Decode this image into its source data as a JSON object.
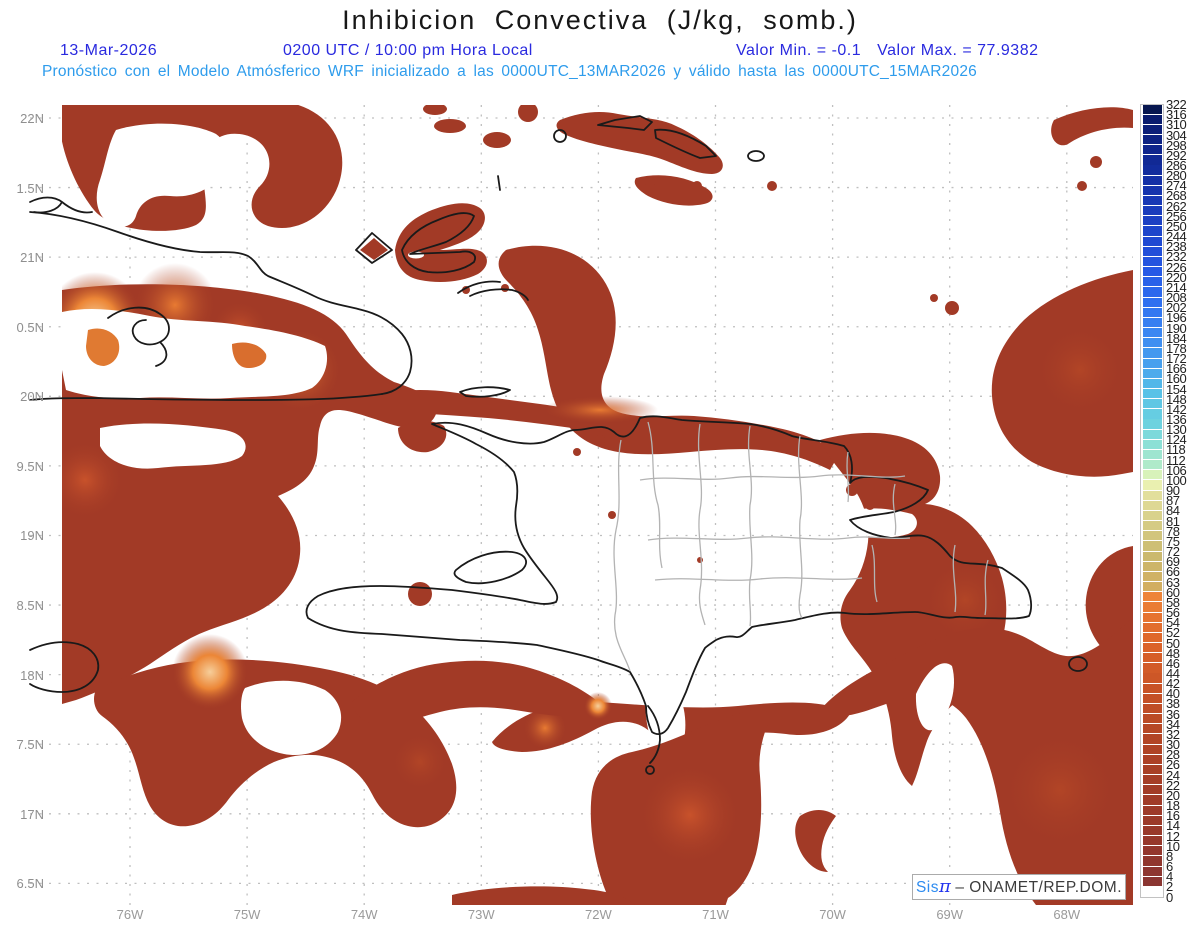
{
  "header": {
    "title": "Inhibicion Convectiva (J/kg, somb.)",
    "date": "13-Mar-2026",
    "valid_time": "0200 UTC / 10:00 pm Hora Local",
    "valor_min": "Valor Min. = -0.1",
    "valor_max": "Valor Max. = 77.9382",
    "model_line": "Pronóstico con el Modelo Atmósferico WRF inicializado a las 0000UTC_13MAR2026 y válido hasta las  0000UTC_15MAR2026"
  },
  "branding": {
    "sis": "Sis",
    "pi": "π",
    "dash": "– ",
    "org": "ONAMET/REP.DOM."
  },
  "axes": {
    "lat_labels": [
      "22N",
      "1.5N",
      "21N",
      "0.5N",
      "20N",
      "9.5N",
      "19N",
      "8.5N",
      "18N",
      "7.5N",
      "17N",
      "6.5N"
    ],
    "lon_labels": [
      "76W",
      "75W",
      "74W",
      "73W",
      "72W",
      "71W",
      "70W",
      "69W",
      "68W"
    ]
  },
  "colorbar": {
    "zero_color": "#FFFFFF",
    "stops": [
      [
        1,
        "#8A3531"
      ],
      [
        5,
        "#96382B"
      ],
      [
        10,
        "#A23C27"
      ],
      [
        15,
        "#B24525"
      ],
      [
        20,
        "#C85326"
      ],
      [
        24,
        "#DB6229"
      ],
      [
        27,
        "#E67330"
      ],
      [
        29,
        "#EE8438"
      ],
      [
        30,
        "#D2AE60"
      ],
      [
        33,
        "#CBB96E"
      ],
      [
        36,
        "#D5CB84"
      ],
      [
        39,
        "#E2DF9C"
      ],
      [
        40,
        "#EAF0B0"
      ],
      [
        41,
        "#D8F2BA"
      ],
      [
        42,
        "#AFEACA"
      ],
      [
        44,
        "#8CE0D6"
      ],
      [
        46,
        "#6DD2DF"
      ],
      [
        49,
        "#58C2E7"
      ],
      [
        52,
        "#47A0EE"
      ],
      [
        55,
        "#3B87F2"
      ],
      [
        58,
        "#2F70F0"
      ],
      [
        61,
        "#2659E6"
      ],
      [
        64,
        "#1F49D2"
      ],
      [
        67,
        "#1A3CBC"
      ],
      [
        70,
        "#1430A6"
      ],
      [
        73,
        "#0F258C"
      ],
      [
        76,
        "#0A1C6E"
      ],
      [
        77,
        "#071750"
      ]
    ]
  },
  "chart_data": {
    "type": "heatmap",
    "title": "Inhibicion Convectiva (J/kg, somb.)",
    "variable": "CIN (inhibicion convectiva)",
    "units": "J/kg",
    "value_min": -0.1,
    "value_max": 77.9382,
    "model": "WRF",
    "init_time": "0000UTC_13MAR2026",
    "valid_until": "0000UTC_15MAR2026",
    "forecast_local_time": "0200 UTC / 10:00 pm Hora Local",
    "forecast_date": "13-Mar-2026",
    "lon_ticks_deg_w": [
      76,
      75,
      74,
      73,
      72,
      71,
      70,
      69,
      68
    ],
    "lat_ticks_deg_n": [
      22,
      21.5,
      21,
      20.5,
      20,
      19.5,
      19,
      18.5,
      18,
      17.5,
      17,
      16.5
    ],
    "region": "Hispaniola / eastern Cuba / Caribbean",
    "colorbar_levels": [
      0,
      2,
      4,
      6,
      8,
      10,
      12,
      14,
      16,
      18,
      20,
      22,
      24,
      26,
      28,
      30,
      32,
      34,
      36,
      38,
      40,
      42,
      44,
      46,
      48,
      50,
      52,
      54,
      56,
      58,
      60,
      63,
      66,
      69,
      72,
      75,
      78,
      81,
      84,
      87,
      90,
      100,
      106,
      112,
      118,
      124,
      130,
      136,
      142,
      148,
      154,
      160,
      166,
      172,
      178,
      184,
      190,
      196,
      202,
      208,
      214,
      220,
      226,
      232,
      238,
      244,
      250,
      256,
      262,
      268,
      274,
      280,
      286,
      292,
      298,
      304,
      310,
      316,
      322
    ]
  }
}
